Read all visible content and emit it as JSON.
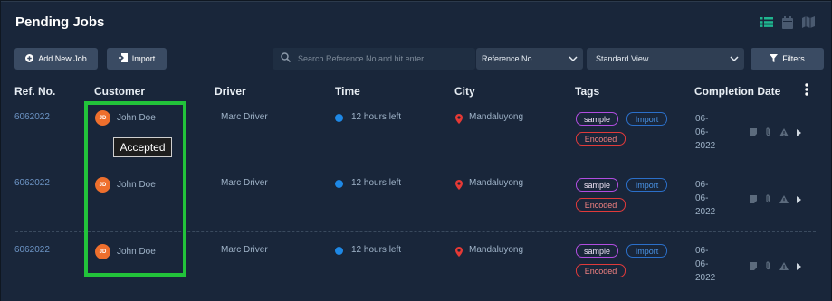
{
  "header": {
    "title": "Pending Jobs"
  },
  "toolbar": {
    "add_new_job_label": "Add New Job",
    "import_label": "Import",
    "search_placeholder": "Search Reference No and hit enter",
    "search_field_value": "Reference No",
    "view_value": "Standard View",
    "filters_label": "Filters"
  },
  "table": {
    "columns": {
      "ref_no": "Ref. No.",
      "customer": "Customer",
      "driver": "Driver",
      "time": "Time",
      "city": "City",
      "tags": "Tags",
      "completion_date": "Completion Date"
    },
    "rows": [
      {
        "ref_no": "6062022",
        "customer_initials": "JD",
        "customer": "John Doe",
        "driver": "Marc Driver",
        "time": "12 hours left",
        "city": "Mandaluyong",
        "tags": [
          "sample",
          "Import",
          "Encoded"
        ],
        "date_lines": [
          "06-",
          "06-",
          "2022"
        ]
      },
      {
        "ref_no": "6062022",
        "customer_initials": "JD",
        "customer": "John Doe",
        "driver": "Marc Driver",
        "time": "12 hours left",
        "city": "Mandaluyong",
        "tags": [
          "sample",
          "Import",
          "Encoded"
        ],
        "date_lines": [
          "06-",
          "06-",
          "2022"
        ]
      },
      {
        "ref_no": "6062022",
        "customer_initials": "JD",
        "customer": "John Doe",
        "driver": "Marc Driver",
        "time": "12 hours left",
        "city": "Mandaluyong",
        "tags": [
          "sample",
          "Import",
          "Encoded"
        ],
        "date_lines": [
          "06-",
          "06-",
          "2022"
        ]
      }
    ]
  },
  "tooltip": {
    "text": "Accepted"
  },
  "icons": {
    "view_list": "list-view-icon",
    "view_calendar": "calendar-view-icon",
    "view_map": "map-view-icon",
    "add": "plus-circle-icon",
    "import": "import-icon",
    "search": "search-icon",
    "chevron": "chevron-down-icon",
    "filter": "filter-icon",
    "kebab": "more-vertical-icon",
    "time": "status-dot-icon",
    "city": "map-pin-icon",
    "note": "note-icon",
    "attachment": "paperclip-icon",
    "warning": "warning-icon",
    "expand": "caret-right-icon"
  },
  "colors": {
    "background": "#19263a",
    "accent_green": "#1fb58f",
    "avatar": "#ee6f2d",
    "status_dot": "#1e88e5",
    "pin": "#e53935",
    "tag_sample": "#b14de0",
    "tag_import": "#2b6fc9",
    "tag_encoded": "#e03a3a",
    "highlight_box": "#22c33a"
  }
}
